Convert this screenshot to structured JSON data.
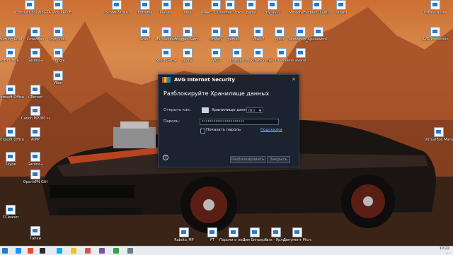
{
  "desktop_icons": [
    {
      "label": "Conduct Solutions"
    },
    {
      "label": "GTA Vice PRO Ed..."
    },
    {
      "label": "Counter-Strike 1.6 Config"
    },
    {
      "label": "Extreme"
    },
    {
      "label": "Players"
    },
    {
      "label": "Vine"
    },
    {
      "label": "MAKE 3 Launcher"
    },
    {
      "label": "Counter-Strike"
    },
    {
      "label": "game"
    },
    {
      "label": "my_avl_j"
    },
    {
      "label": "Minecraft"
    },
    {
      "label": "Hexplex (Lalit) 1"
    },
    {
      "label": "wizard"
    },
    {
      "label": "Offline Notes"
    },
    {
      "label": "ideal"
    },
    {
      "label": "Burning ROM"
    },
    {
      "label": "Crowdfish"
    },
    {
      "label": "UnityVid..."
    },
    {
      "label": "Gran7"
    },
    {
      "label": "MS Standard"
    },
    {
      "label": "Frogger_Sam..."
    },
    {
      "label": "Orphey"
    },
    {
      "label": "game1"
    },
    {
      "label": "Vitas-7"
    },
    {
      "label": "git_n"
    },
    {
      "label": "Workshop_A..."
    },
    {
      "label": "password"
    },
    {
      "label": "AVG Protection"
    },
    {
      "label": "Hotspot"
    },
    {
      "label": "ABBYY Fine..."
    },
    {
      "label": "Tunngle"
    },
    {
      "label": "Sport Game"
    },
    {
      "label": "game"
    },
    {
      "label": "VKG"
    },
    {
      "label": "Untitled"
    },
    {
      "label": "Maxcraft-Skins"
    },
    {
      "label": "hex Deviceless App"
    },
    {
      "label": "avatar"
    },
    {
      "label": "Garena+"
    },
    {
      "label": "Viber"
    },
    {
      "label": "Microsoft Office 2010"
    },
    {
      "label": "uTorrent"
    },
    {
      "label": "Canon MP280 seri..."
    },
    {
      "label": "Yandex"
    },
    {
      "label": "Microsoft Office 2010"
    },
    {
      "label": "AIMP"
    },
    {
      "label": "VirtualBox Manager"
    },
    {
      "label": "Skype"
    },
    {
      "label": "Garena+"
    },
    {
      "label": "Opera"
    },
    {
      "label": "OpenVPN GUI"
    },
    {
      "label": "CCleaner"
    },
    {
      "label": "Тапки"
    },
    {
      "label": "Rabota_MP"
    },
    {
      "label": "PT"
    },
    {
      "label": "Пароли и логины"
    },
    {
      "label": "Для Биндера"
    },
    {
      "label": "Pass - Ярлык"
    },
    {
      "label": "Документ Microsoft..."
    },
    {
      "label": "123"
    }
  ],
  "dialog": {
    "brand": "Internet Security",
    "logo_text": "AVG",
    "heading": "Разблокируйте Хранилище данных",
    "open_as_label": "Открыть как:",
    "vault_name": "Хранилище данных",
    "drive_letter": "(X:)",
    "password_label": "Пароль:",
    "password_value": "••••••••••••••••••••••",
    "show_password_label": "Показать пароль",
    "hint_link": "Подсказка",
    "help_glyph": "?",
    "unlock_button": "Разблокировать",
    "close_button": "Закрыть",
    "close_glyph": "×"
  },
  "taskbar": {
    "clock_time": "10:22",
    "clock_date": "..."
  },
  "colors": {
    "dialog_bg": "#1b2230",
    "accent_link": "#7fb3ff",
    "taskbar_bg": "#e8ecf1"
  }
}
